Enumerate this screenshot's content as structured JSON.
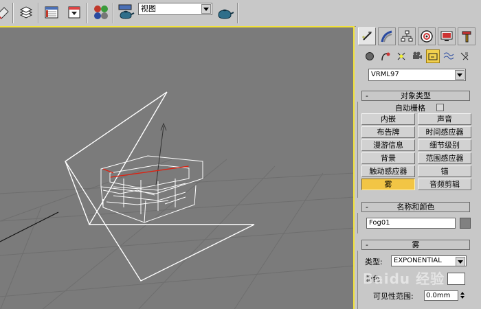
{
  "toolbar": {
    "view_select_value": "视图",
    "icons": [
      "eraser-icon",
      "layers-icon",
      "track-view-icon",
      "schematic-view-icon",
      "material-editor-icon",
      "render-scene-icon",
      "quick-render-icon"
    ]
  },
  "command_panel": {
    "tabs": [
      "create-tab",
      "modify-tab",
      "hierarchy-tab",
      "motion-tab",
      "display-tab",
      "utilities-tab"
    ],
    "sub_icons": [
      "geometry-icon",
      "shapes-icon",
      "lights-icon",
      "cameras-icon",
      "helpers-icon",
      "space-warps-icon",
      "systems-icon"
    ],
    "category_select": "VRML97",
    "object_type": {
      "title": "对象类型",
      "auto_grid_label": "自动栅格",
      "buttons": [
        "内嵌",
        "声音",
        "布告牌",
        "时间感应器",
        "漫游信息",
        "细节级别",
        "背景",
        "范围感应器",
        "触动感应器",
        "锚",
        "雾",
        "音频剪辑"
      ],
      "active_button": "雾"
    },
    "name_color": {
      "title": "名称和颜色",
      "name_value": "Fog01",
      "color": "#808080"
    },
    "fog": {
      "title": "雾",
      "type_label": "类型:",
      "type_value": "EXPONENTIAL",
      "color_label": "颜色:",
      "color_value": "#ffffff",
      "visibility_label": "可见性范围:",
      "visibility_value": "0.0mm"
    }
  },
  "watermark": "Baidu 经验",
  "colors": {
    "viewport_bg": "#7b7b7b",
    "active_border": "#f2e23a",
    "active_button": "#f2c545"
  }
}
